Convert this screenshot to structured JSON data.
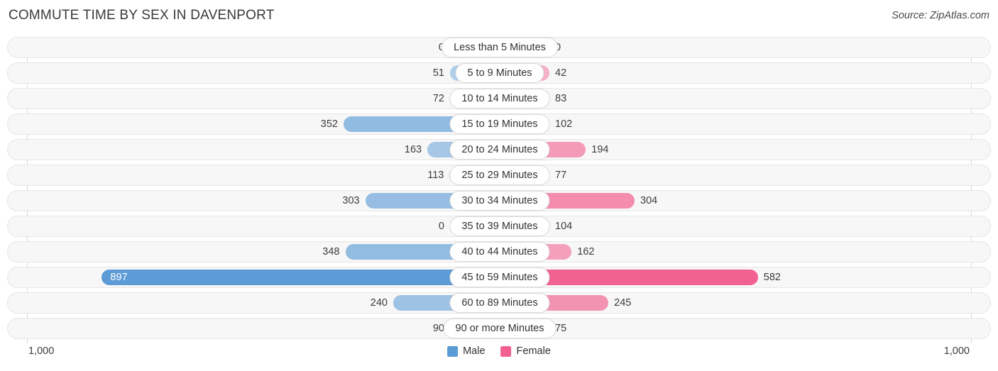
{
  "header": {
    "title": "COMMUTE TIME BY SEX IN DAVENPORT",
    "source": "Source: ZipAtlas.com"
  },
  "axis": {
    "left_label": "1,000",
    "right_label": "1,000"
  },
  "legend": {
    "items": [
      {
        "label": "Male",
        "color": "#5b9bd5"
      },
      {
        "label": "Female",
        "color": "#f2608f"
      }
    ]
  },
  "chart_data": {
    "type": "bar",
    "title": "COMMUTE TIME BY SEX IN DAVENPORT",
    "orientation": "horizontal-diverging",
    "xlabel": "",
    "ylabel": "",
    "xlim": [
      1000,
      1000
    ],
    "grid": true,
    "legend_position": "bottom-center",
    "categories": [
      "Less than 5 Minutes",
      "5 to 9 Minutes",
      "10 to 14 Minutes",
      "15 to 19 Minutes",
      "20 to 24 Minutes",
      "25 to 29 Minutes",
      "30 to 34 Minutes",
      "35 to 39 Minutes",
      "40 to 44 Minutes",
      "45 to 59 Minutes",
      "60 to 89 Minutes",
      "90 or more Minutes"
    ],
    "series": [
      {
        "name": "Male",
        "color": "#5b9bd5",
        "values": [
          0,
          51,
          72,
          352,
          163,
          113,
          303,
          0,
          348,
          897,
          240,
          90
        ],
        "labels": [
          "0",
          "51",
          "72",
          "352",
          "163",
          "113",
          "303",
          "0",
          "348",
          "897",
          "240",
          "90"
        ]
      },
      {
        "name": "Female",
        "color": "#f2608f",
        "values": [
          0,
          42,
          83,
          102,
          194,
          77,
          304,
          104,
          162,
          582,
          245,
          75
        ],
        "labels": [
          "0",
          "42",
          "83",
          "102",
          "194",
          "77",
          "304",
          "104",
          "162",
          "582",
          "245",
          "75"
        ]
      }
    ]
  }
}
